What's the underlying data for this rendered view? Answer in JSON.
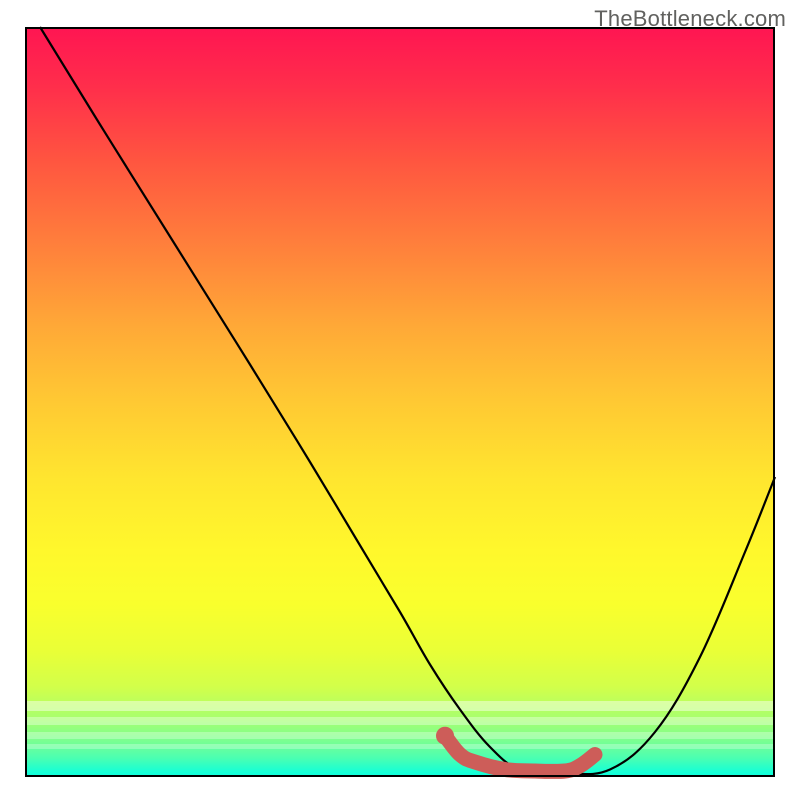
{
  "watermark": "TheBottleneck.com",
  "chart_data": {
    "type": "line",
    "title": "",
    "xlabel": "",
    "ylabel": "",
    "xlim": [
      0,
      100
    ],
    "ylim": [
      0,
      100
    ],
    "grid": false,
    "series": [
      {
        "name": "curve",
        "color": "#000000",
        "x": [
          2,
          10,
          20,
          30,
          38,
          44,
          50,
          54,
          58,
          62,
          66,
          72,
          78,
          84,
          90,
          96,
          100
        ],
        "y": [
          100,
          87,
          71,
          55,
          42,
          32,
          22,
          15,
          9,
          4,
          1,
          0.5,
          1,
          6,
          16,
          30,
          40
        ]
      },
      {
        "name": "highlight",
        "color": "#cd5d59",
        "x": [
          56,
          58,
          60,
          64,
          68,
          72,
          74,
          76
        ],
        "y": [
          5.5,
          3,
          2,
          1,
          0.8,
          0.8,
          1.5,
          3
        ]
      }
    ],
    "background_gradient": {
      "stops": [
        {
          "pos": 0.0,
          "color": "#ff1552"
        },
        {
          "pos": 0.5,
          "color": "#ffc933"
        },
        {
          "pos": 0.8,
          "color": "#f0ff33"
        },
        {
          "pos": 1.0,
          "color": "#0affdf"
        }
      ]
    }
  }
}
